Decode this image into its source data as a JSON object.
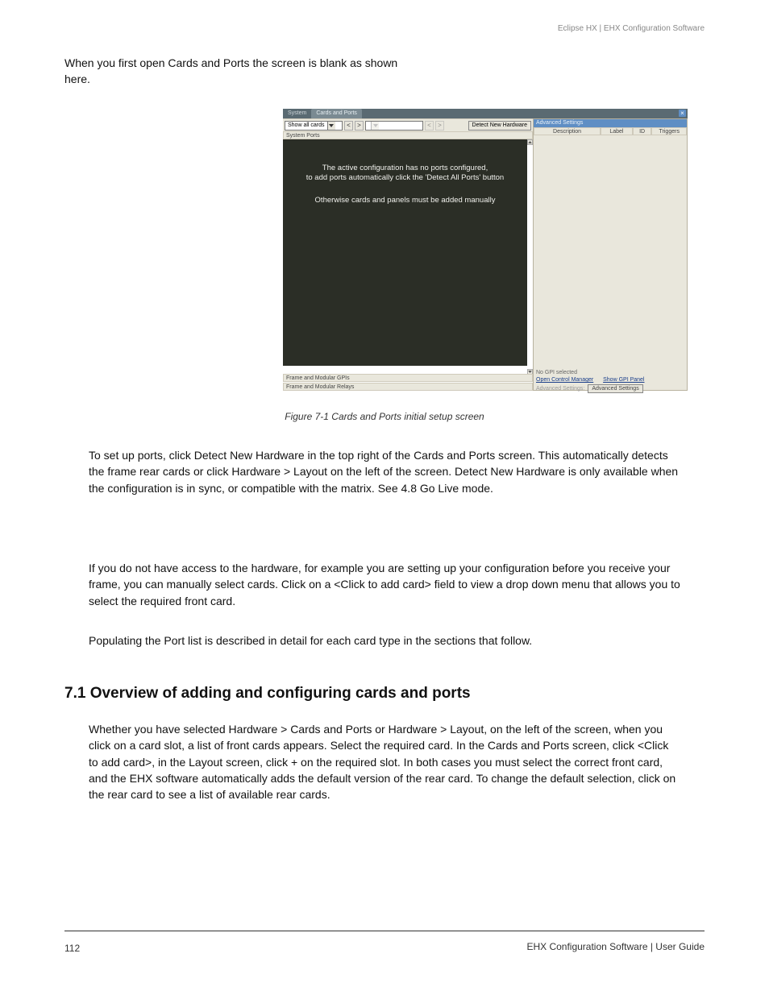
{
  "document": {
    "header_id": "Eclipse HX | EHX Configuration Software",
    "intro_line1": "When you first open Cards and Ports the screen is blank as shown",
    "intro_line2": "here.",
    "figure_caption": "Figure 7-1 Cards and Ports initial setup screen",
    "para_detect": "To set up ports, click Detect New Hardware in the top right of the Cards and Ports screen. This automatically detects the frame rear cards or click Hardware > Layout on the left of the screen. Detect New Hardware is only available when the configuration is in sync, or compatible with the matrix. See 4.8 Go Live mode.",
    "para_manual": "If you do not have access to the hardware, for example you are setting up your configuration before you receive your frame, you can manually select cards. Click on a <Click to add card> field to view a drop down menu that allows you to select the required front card.",
    "para_manual2": "Populating the Port list is described in detail for each card type in the sections that follow.",
    "overview_heading": "7.1   Overview of adding and configuring cards and ports",
    "overview_body": "Whether you have selected Hardware > Cards and Ports or Hardware > Layout, on the left of the screen, when you click on a card slot, a list of front cards appears. Select the required card. In the Cards and Ports screen, click <Click to add card>, in the Layout screen, click + on the required slot. In both cases you must select the correct front card, and the EHX software automatically adds the default version of the rear card. To change the default selection, click on the rear card to see a list of available rear cards.",
    "foot_page": "112",
    "foot_manual": "EHX Configuration Software | User Guide"
  },
  "ui": {
    "tabs": {
      "system": "System",
      "cards": "Cards and Ports"
    },
    "close_x": "×",
    "show_all": "Show all cards",
    "nav_prev": "<",
    "nav_next": ">",
    "empty_combo": "",
    "detect_btn": "Detect New Hardware",
    "system_ports": "System Ports",
    "msg1": "The active configuration has no ports configured,",
    "msg2": "to add ports automatically click the 'Detect All Ports' button",
    "msg3": "Otherwise cards and panels must be added manually",
    "frame_gpis": "Frame and Modular GPIs",
    "frame_relays": "Frame and Modular Relays",
    "right": {
      "title": "Advanced Settings",
      "desc": "Description",
      "label": "Label",
      "id": "ID",
      "triggers": "Triggers",
      "no_gpi": "No GPI selected",
      "open_cm": "Open Control Manager",
      "show_gpi": "Show GPI Panel",
      "adv_label": "Advanced Settings:",
      "adv_btn": "Advanced Settings"
    }
  }
}
